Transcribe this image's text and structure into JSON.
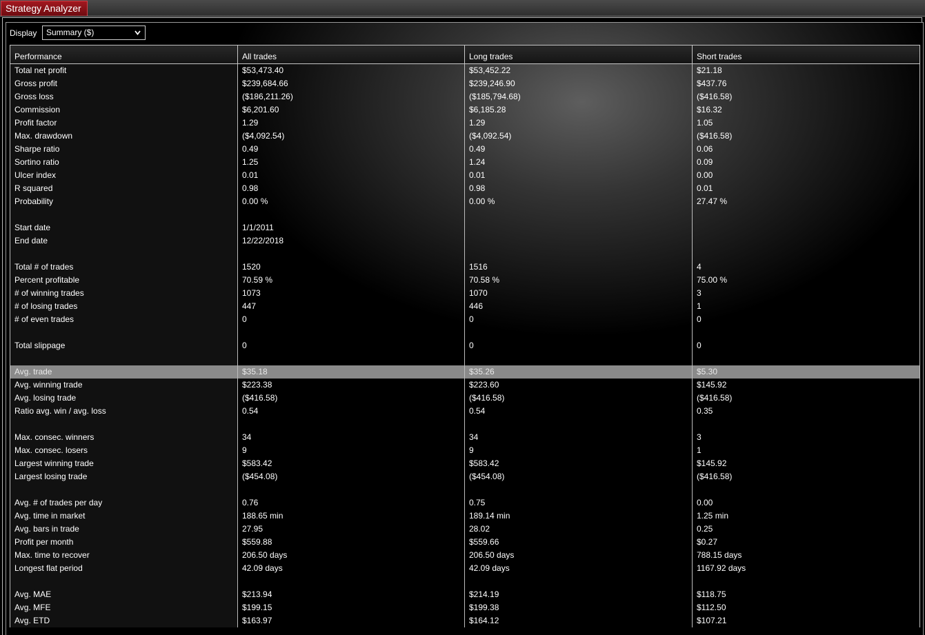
{
  "window": {
    "title": "Strategy Analyzer"
  },
  "display": {
    "label": "Display",
    "selected": "Summary ($)"
  },
  "columns": [
    "Performance",
    "All trades",
    "Long trades",
    "Short trades"
  ],
  "rows": [
    {
      "label": "Total net profit",
      "values": [
        "$53,473.40",
        "$53,452.22",
        "$21.18"
      ]
    },
    {
      "label": "Gross profit",
      "values": [
        "$239,684.66",
        "$239,246.90",
        "$437.76"
      ]
    },
    {
      "label": "Gross loss",
      "values": [
        "($186,211.26)",
        "($185,794.68)",
        "($416.58)"
      ],
      "negative": true
    },
    {
      "label": "Commission",
      "values": [
        "$6,201.60",
        "$6,185.28",
        "$16.32"
      ]
    },
    {
      "label": "Profit factor",
      "values": [
        "1.29",
        "1.29",
        "1.05"
      ]
    },
    {
      "label": "Max. drawdown",
      "values": [
        "($4,092.54)",
        "($4,092.54)",
        "($416.58)"
      ],
      "negative": true
    },
    {
      "label": "Sharpe ratio",
      "values": [
        "0.49",
        "0.49",
        "0.06"
      ]
    },
    {
      "label": "Sortino ratio",
      "values": [
        "1.25",
        "1.24",
        "0.09"
      ]
    },
    {
      "label": "Ulcer index",
      "values": [
        "0.01",
        "0.01",
        "0.00"
      ]
    },
    {
      "label": "R squared",
      "values": [
        "0.98",
        "0.98",
        "0.01"
      ]
    },
    {
      "label": "Probability",
      "values": [
        "0.00 %",
        "0.00 %",
        "27.47 %"
      ]
    },
    {
      "label": "",
      "values": [
        "",
        "",
        ""
      ]
    },
    {
      "label": "Start date",
      "values": [
        "1/1/2011",
        "",
        ""
      ]
    },
    {
      "label": "End date",
      "values": [
        "12/22/2018",
        "",
        ""
      ]
    },
    {
      "label": "",
      "values": [
        "",
        "",
        ""
      ]
    },
    {
      "label": "Total # of trades",
      "values": [
        "1520",
        "1516",
        "4"
      ]
    },
    {
      "label": "Percent profitable",
      "values": [
        "70.59 %",
        "70.58 %",
        "75.00 %"
      ]
    },
    {
      "label": "# of winning trades",
      "values": [
        "1073",
        "1070",
        "3"
      ]
    },
    {
      "label": "# of losing trades",
      "values": [
        "447",
        "446",
        "1"
      ]
    },
    {
      "label": "# of even trades",
      "values": [
        "0",
        "0",
        "0"
      ]
    },
    {
      "label": "",
      "values": [
        "",
        "",
        ""
      ]
    },
    {
      "label": "Total slippage",
      "values": [
        "0",
        "0",
        "0"
      ]
    },
    {
      "label": "",
      "values": [
        "",
        "",
        ""
      ]
    },
    {
      "label": "Avg. trade",
      "values": [
        "$35.18",
        "$35.26",
        "$5.30"
      ],
      "selected": true
    },
    {
      "label": "Avg. winning trade",
      "values": [
        "$223.38",
        "$223.60",
        "$145.92"
      ]
    },
    {
      "label": "Avg. losing trade",
      "values": [
        "($416.58)",
        "($416.58)",
        "($416.58)"
      ],
      "negative": true
    },
    {
      "label": "Ratio avg. win / avg. loss",
      "values": [
        "0.54",
        "0.54",
        "0.35"
      ]
    },
    {
      "label": "",
      "values": [
        "",
        "",
        ""
      ]
    },
    {
      "label": "Max. consec. winners",
      "values": [
        "34",
        "34",
        "3"
      ]
    },
    {
      "label": "Max. consec. losers",
      "values": [
        "9",
        "9",
        "1"
      ]
    },
    {
      "label": "Largest winning trade",
      "values": [
        "$583.42",
        "$583.42",
        "$145.92"
      ]
    },
    {
      "label": "Largest losing trade",
      "values": [
        "($454.08)",
        "($454.08)",
        "($416.58)"
      ],
      "negative": true
    },
    {
      "label": "",
      "values": [
        "",
        "",
        ""
      ]
    },
    {
      "label": "Avg. # of trades per day",
      "values": [
        "0.76",
        "0.75",
        "0.00"
      ]
    },
    {
      "label": "Avg. time in market",
      "values": [
        "188.65 min",
        "189.14 min",
        "1.25 min"
      ]
    },
    {
      "label": "Avg. bars in trade",
      "values": [
        "27.95",
        "28.02",
        "0.25"
      ]
    },
    {
      "label": "Profit per month",
      "values": [
        "$559.88",
        "$559.66",
        "$0.27"
      ]
    },
    {
      "label": "Max. time to recover",
      "values": [
        "206.50 days",
        "206.50 days",
        "788.15 days"
      ]
    },
    {
      "label": "Longest flat period",
      "values": [
        "42.09 days",
        "42.09 days",
        "1167.92 days"
      ]
    },
    {
      "label": "",
      "values": [
        "",
        "",
        ""
      ]
    },
    {
      "label": "Avg. MAE",
      "values": [
        "$213.94",
        "$214.19",
        "$118.75"
      ]
    },
    {
      "label": "Avg. MFE",
      "values": [
        "$199.15",
        "$199.38",
        "$112.50"
      ]
    },
    {
      "label": "Avg. ETD",
      "values": [
        "$163.97",
        "$164.12",
        "$107.21"
      ]
    }
  ],
  "colors": {
    "negative": "#ff2020",
    "title_tab": "#a21820",
    "selected_row": "#8a8a8a"
  },
  "icons": {
    "dropdown": "chevron-down-icon"
  }
}
